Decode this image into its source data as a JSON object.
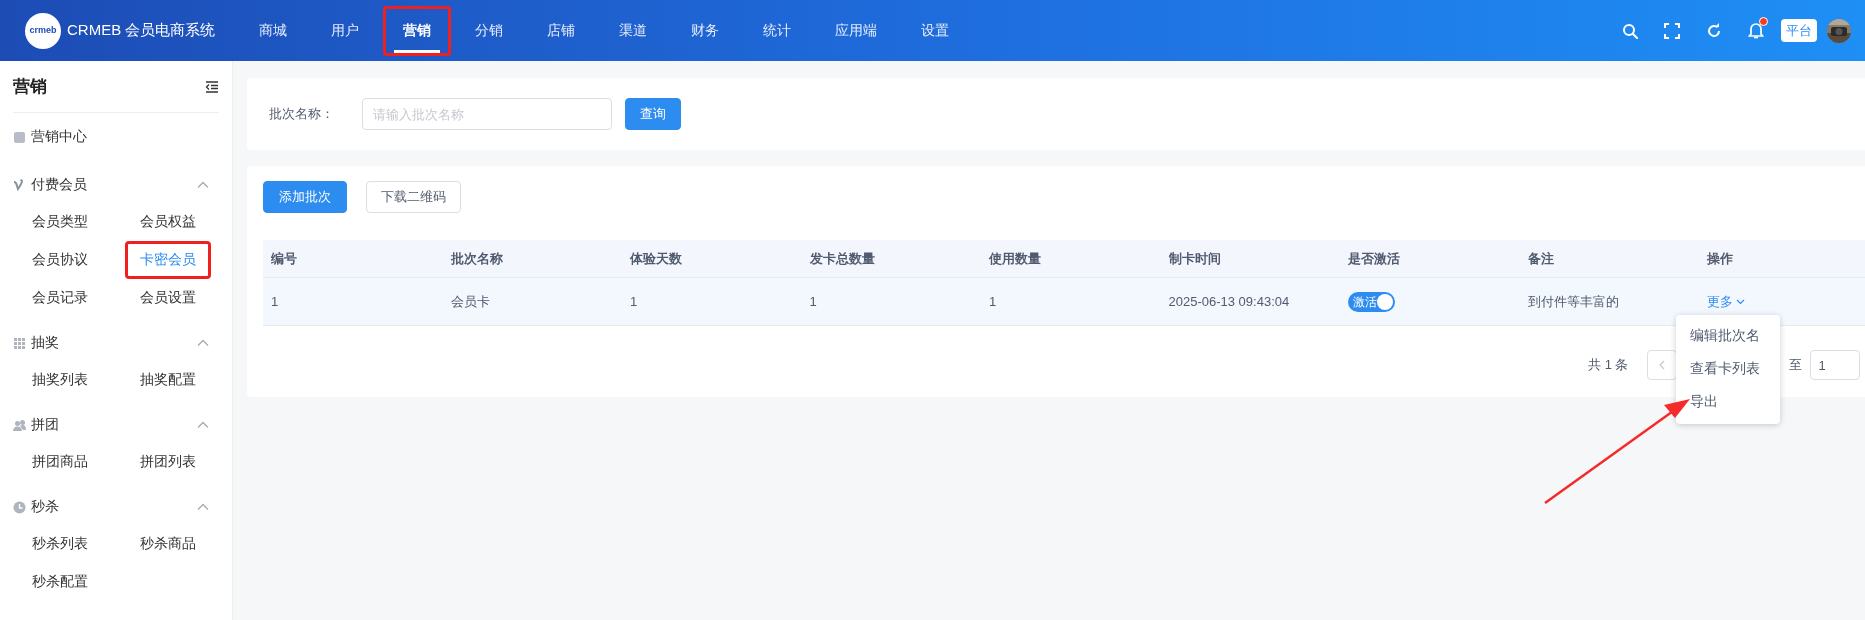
{
  "header": {
    "logo_text": "crmeb",
    "title": "CRMEB 会员电商系统",
    "nav": [
      {
        "label": "商城",
        "selected": false,
        "highlighted": false
      },
      {
        "label": "用户",
        "selected": false,
        "highlighted": false
      },
      {
        "label": "营销",
        "selected": true,
        "highlighted": true
      },
      {
        "label": "分销",
        "selected": false,
        "highlighted": false
      },
      {
        "label": "店铺",
        "selected": false,
        "highlighted": false
      },
      {
        "label": "渠道",
        "selected": false,
        "highlighted": false
      },
      {
        "label": "财务",
        "selected": false,
        "highlighted": false
      },
      {
        "label": "统计",
        "selected": false,
        "highlighted": false
      },
      {
        "label": "应用端",
        "selected": false,
        "highlighted": false
      },
      {
        "label": "设置",
        "selected": false,
        "highlighted": false
      }
    ],
    "notification_dot": true,
    "platform_badge": "平台"
  },
  "sidebar": {
    "title": "营销",
    "groups": [
      {
        "kind": "link",
        "label": "营销中心"
      },
      {
        "kind": "group",
        "label": "付费会员",
        "expanded": true,
        "children": [
          {
            "label": "会员类型",
            "selected": false,
            "highlighted": false
          },
          {
            "label": "会员权益",
            "selected": false,
            "highlighted": false
          },
          {
            "label": "会员协议",
            "selected": false,
            "highlighted": false
          },
          {
            "label": "卡密会员",
            "selected": true,
            "highlighted": true
          },
          {
            "label": "会员记录",
            "selected": false,
            "highlighted": false
          },
          {
            "label": "会员设置",
            "selected": false,
            "highlighted": false
          }
        ]
      },
      {
        "kind": "group",
        "label": "抽奖",
        "expanded": true,
        "children": [
          {
            "label": "抽奖列表",
            "selected": false,
            "highlighted": false
          },
          {
            "label": "抽奖配置",
            "selected": false,
            "highlighted": false
          }
        ]
      },
      {
        "kind": "group",
        "label": "拼团",
        "expanded": true,
        "children": [
          {
            "label": "拼团商品",
            "selected": false,
            "highlighted": false
          },
          {
            "label": "拼团列表",
            "selected": false,
            "highlighted": false
          }
        ]
      },
      {
        "kind": "group",
        "label": "秒杀",
        "expanded": true,
        "children": [
          {
            "label": "秒杀列表",
            "selected": false,
            "highlighted": false
          },
          {
            "label": "秒杀商品",
            "selected": false,
            "highlighted": false
          },
          {
            "label": "秒杀配置",
            "selected": false,
            "highlighted": false
          }
        ]
      }
    ]
  },
  "search": {
    "label": "批次名称：",
    "placeholder": "请输入批次名称",
    "button": "查询"
  },
  "toolbar": [
    {
      "kind": "primary",
      "label": "添加批次"
    },
    {
      "kind": "default",
      "label": "下载二维码"
    }
  ],
  "table": {
    "columns": [
      "编号",
      "批次名称",
      "体验天数",
      "发卡总数量",
      "使用数量",
      "制卡时间",
      "是否激活",
      "备注",
      "操作"
    ],
    "rows": [
      {
        "cells": [
          "1",
          "会员卡",
          "1",
          "1",
          "1",
          "2025-06-13 09:43:04"
        ],
        "active": {
          "label": "激活",
          "on": true
        },
        "remark": "到付件等丰富的",
        "action": "更多"
      }
    ]
  },
  "pagination": {
    "total": "共 1 条",
    "jump_label": "至",
    "page_input": "1"
  },
  "dropdown": {
    "open": true,
    "items": [
      "编辑批次名",
      "查看卡列表",
      "导出"
    ]
  },
  "annotation_arrow": true
}
